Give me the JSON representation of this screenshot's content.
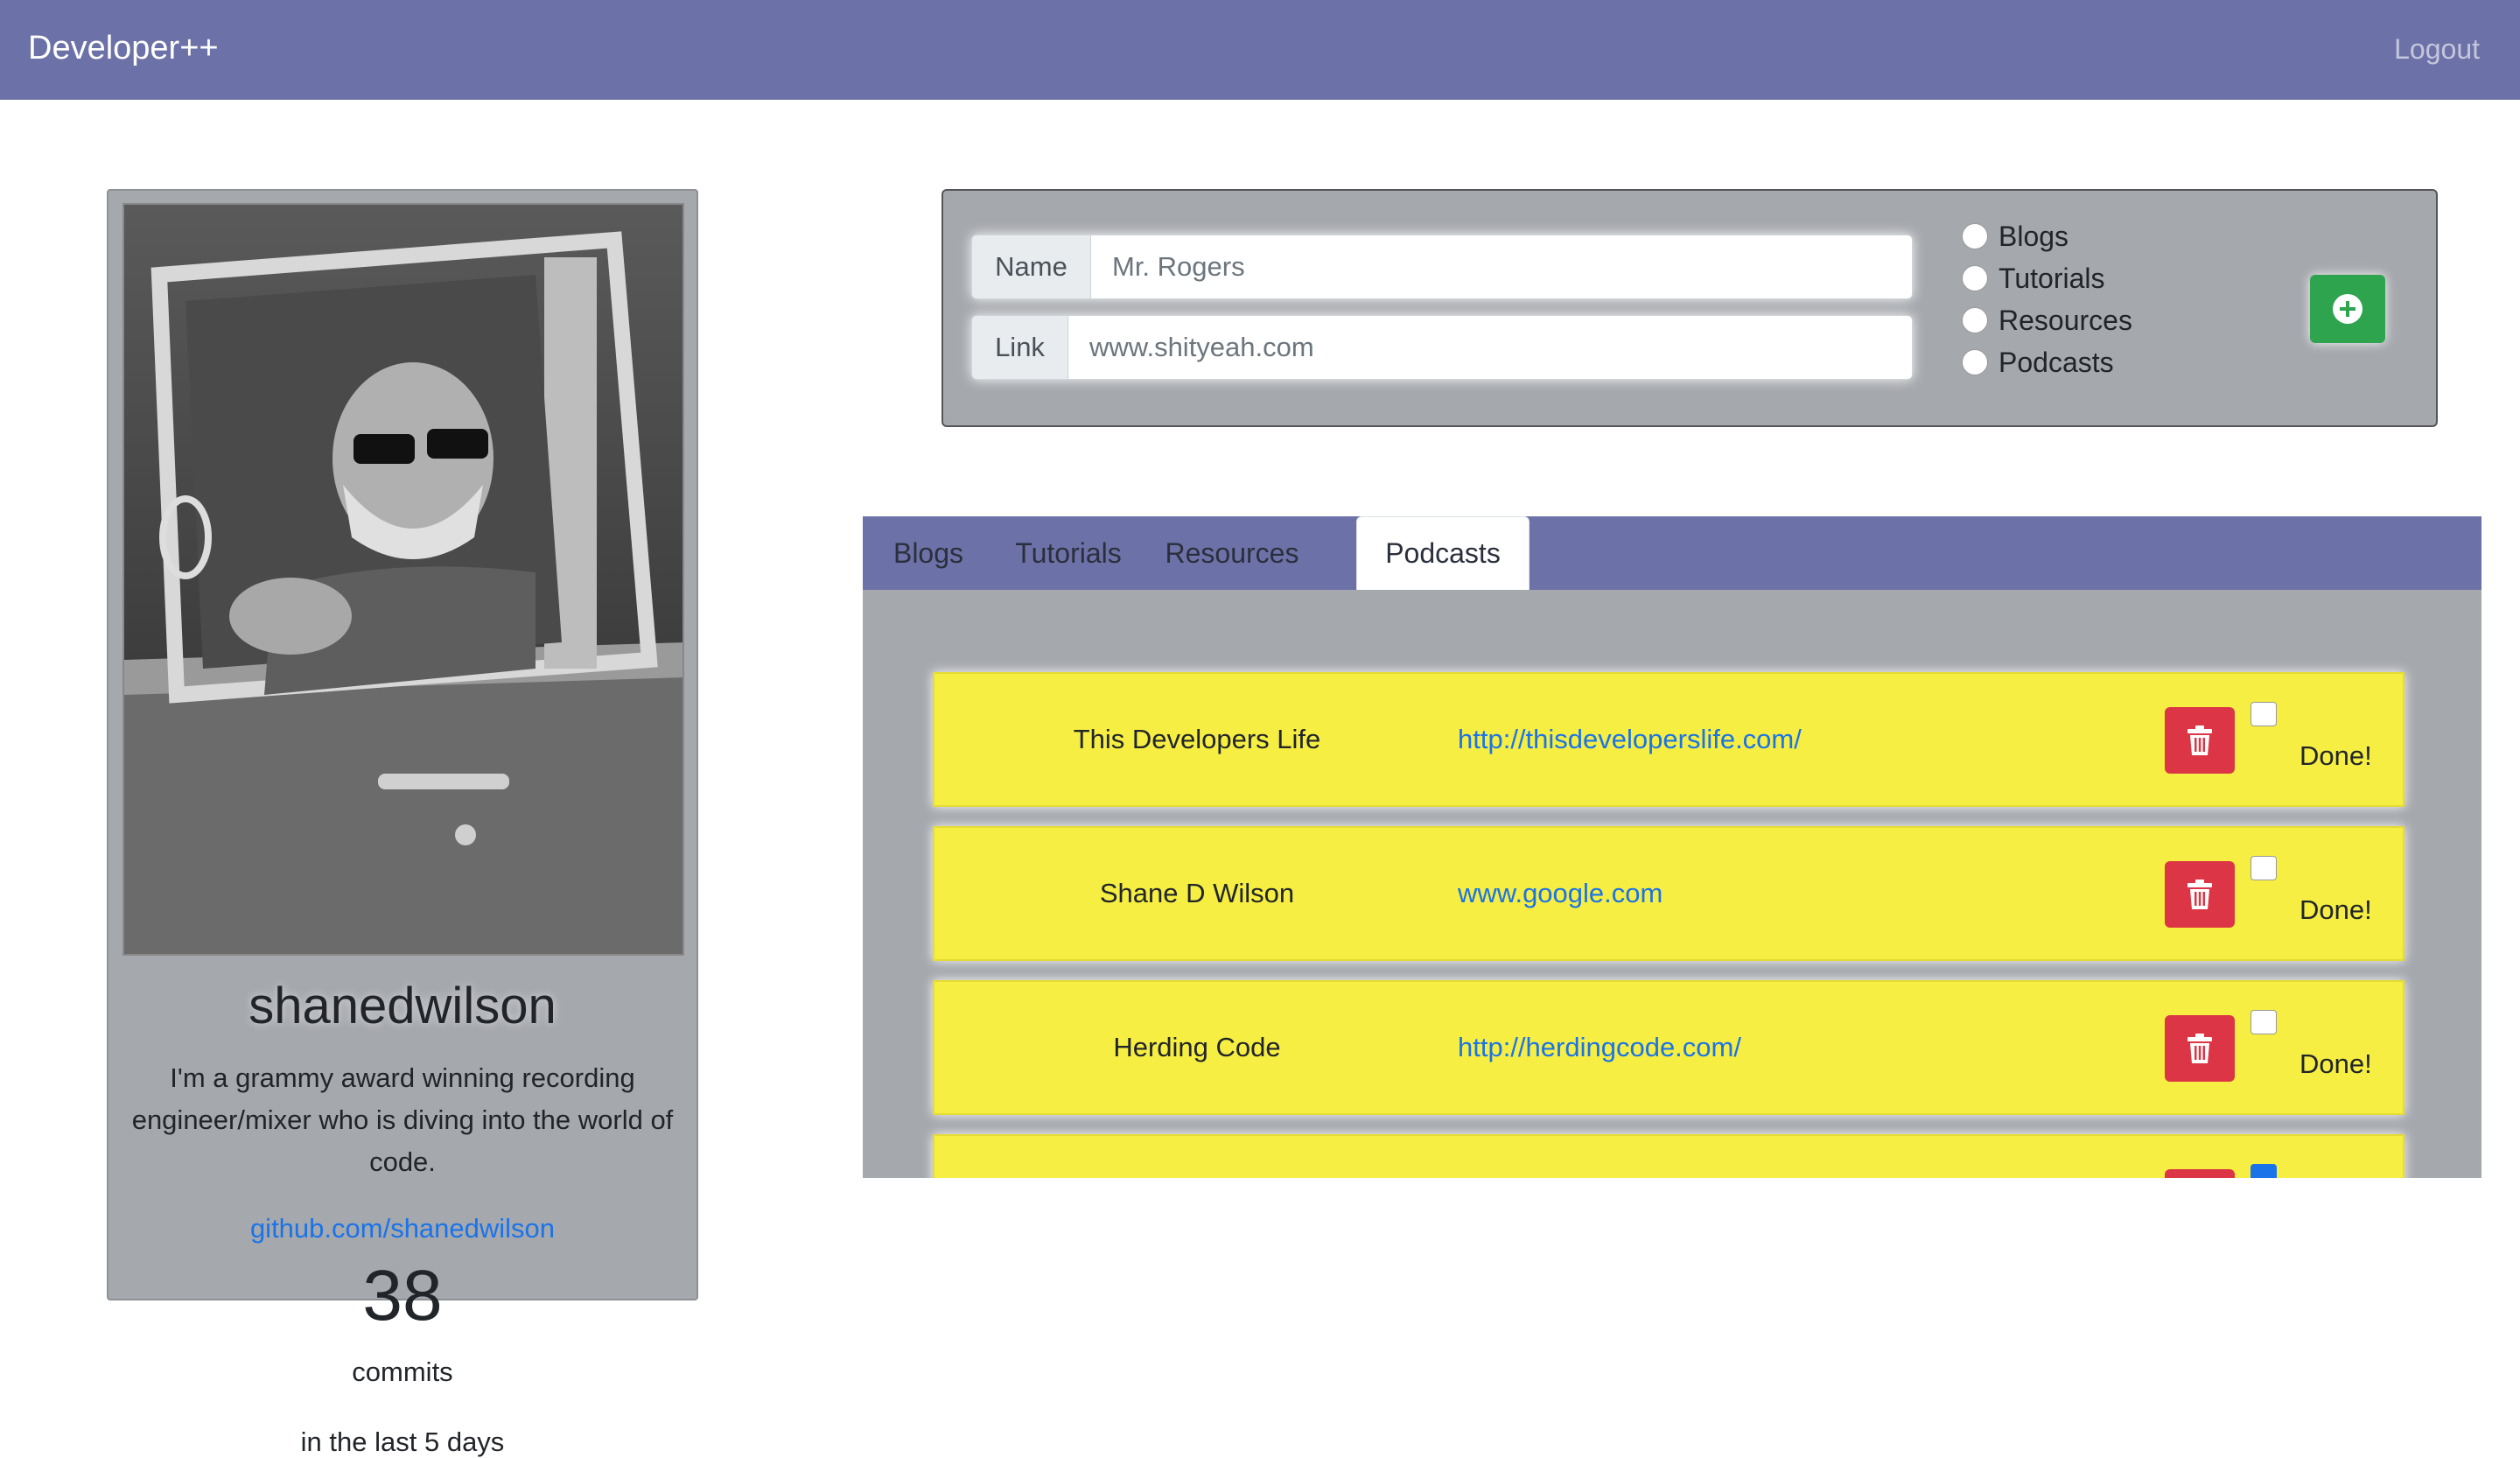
{
  "navbar": {
    "brand": "Developer++",
    "logout": "Logout"
  },
  "profile": {
    "username": "shanedwilson",
    "bio": "I'm a grammy award winning recording engineer/mixer who is diving into the world of code.",
    "github": "github.com/shanedwilson",
    "commit_count": "38",
    "commits_label": "commits",
    "commits_range": "in the last 5 days"
  },
  "form": {
    "name_label": "Name",
    "name_placeholder": "Mr. Rogers",
    "link_label": "Link",
    "link_placeholder": "www.shityeah.com",
    "categories": [
      "Blogs",
      "Tutorials",
      "Resources",
      "Podcasts"
    ],
    "add_icon": "plus-circle-icon",
    "add_color": "#2ea44f"
  },
  "tabs": [
    {
      "label": "Blogs",
      "active": false
    },
    {
      "label": "Tutorials",
      "active": false
    },
    {
      "label": "Resources",
      "active": false
    },
    {
      "label": "Podcasts",
      "active": true
    }
  ],
  "podcasts": [
    {
      "name": "This Developers Life",
      "url": "http://thisdeveloperslife.com/",
      "done": false,
      "done_label": "Done!"
    },
    {
      "name": "Shane D Wilson",
      "url": "www.google.com",
      "done": false,
      "done_label": "Done!"
    },
    {
      "name": "Herding Code",
      "url": "http://herdingcode.com/",
      "done": false,
      "done_label": "Done!"
    },
    {
      "name": "",
      "url": "",
      "done": true,
      "done_label": ""
    }
  ],
  "colors": {
    "navbar": "#6c72a7",
    "card_bg": "#a5a8ad",
    "item_bg": "#f6ee42",
    "delete": "#dc3545",
    "link": "#1a73e8"
  },
  "icons": {
    "delete": "trash-icon",
    "add": "plus-circle-icon"
  }
}
